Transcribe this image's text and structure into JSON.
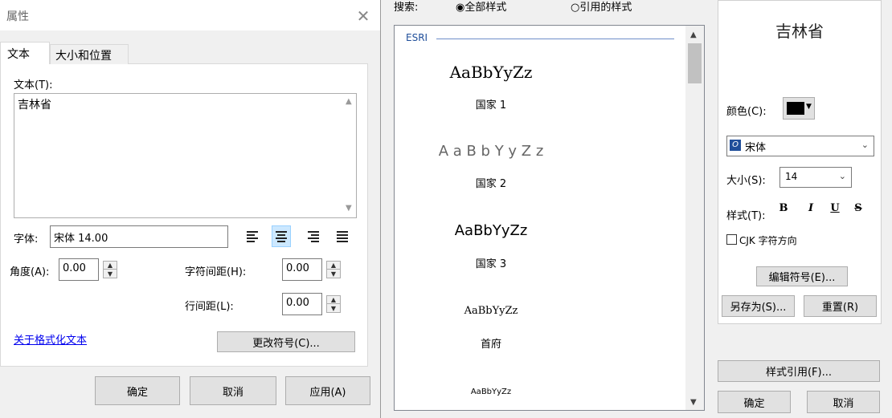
{
  "properties_dialog": {
    "title": "属性",
    "tabs": [
      {
        "label": "文本"
      },
      {
        "label": "大小和位置"
      }
    ],
    "text_label": "文本(T):",
    "text_value": "吉林省",
    "font_label": "字体:",
    "font_value": "宋体 14.00",
    "angle_label": "角度(A):",
    "angle_value": "0.00",
    "char_spacing_label": "字符间距(H):",
    "char_spacing_value": "0.00",
    "line_spacing_label": "行间距(L):",
    "line_spacing_value": "0.00",
    "about_link": "关于格式化文本",
    "change_symbol": "更改符号(C)...",
    "ok": "确定",
    "cancel": "取消",
    "apply": "应用(A)"
  },
  "style_selector": {
    "search_label": "搜索:",
    "search_options": [
      {
        "label": "全部样式",
        "selected": true
      },
      {
        "label": "引用的样式",
        "selected": false
      }
    ],
    "group_label": "ESRI",
    "items": [
      {
        "sample": "AaBbYyZz",
        "name": "国家 1"
      },
      {
        "sample": "A a B b Y y Z z",
        "name": "国家 2"
      },
      {
        "sample": "AaBbYyZz",
        "name": "国家 3"
      },
      {
        "sample": "AaBbYyZz",
        "name": "首府"
      },
      {
        "sample": "AaBbYyZz",
        "name": ""
      }
    ]
  },
  "symbol_panel": {
    "preview_text": "吉林省",
    "color_label": "颜色(C):",
    "color_value": "#000000",
    "font_name": "宋体",
    "size_label": "大小(S):",
    "size_value": "14",
    "style_label": "样式(T):",
    "style_buttons": [
      "B",
      "I",
      "U",
      "S"
    ],
    "cjk_label": "CJK 字符方向",
    "edit_symbol": "编辑符号(E)...",
    "save_as": "另存为(S)...",
    "reset": "重置(R)",
    "style_refs": "样式引用(F)...",
    "ok": "确定",
    "cancel": "取消"
  }
}
